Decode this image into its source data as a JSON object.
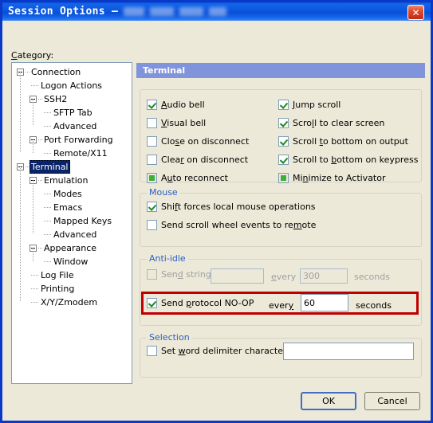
{
  "window": {
    "title_prefix": "Session Options –",
    "title_redacted": true,
    "close_label": "✕"
  },
  "category": {
    "label": "Category:",
    "label_accel": "C",
    "tree": [
      {
        "text": "Connection",
        "depth": 0,
        "expandable": true,
        "selected": false
      },
      {
        "text": "Logon Actions",
        "depth": 1,
        "expandable": false,
        "selected": false
      },
      {
        "text": "SSH2",
        "depth": 1,
        "expandable": true,
        "selected": false
      },
      {
        "text": "SFTP Tab",
        "depth": 2,
        "expandable": false,
        "selected": false
      },
      {
        "text": "Advanced",
        "depth": 2,
        "expandable": false,
        "selected": false
      },
      {
        "text": "Port Forwarding",
        "depth": 1,
        "expandable": true,
        "selected": false
      },
      {
        "text": "Remote/X11",
        "depth": 2,
        "expandable": false,
        "selected": false
      },
      {
        "text": "Terminal",
        "depth": 0,
        "expandable": true,
        "selected": true
      },
      {
        "text": "Emulation",
        "depth": 1,
        "expandable": true,
        "selected": false
      },
      {
        "text": "Modes",
        "depth": 2,
        "expandable": false,
        "selected": false
      },
      {
        "text": "Emacs",
        "depth": 2,
        "expandable": false,
        "selected": false
      },
      {
        "text": "Mapped Keys",
        "depth": 2,
        "expandable": false,
        "selected": false
      },
      {
        "text": "Advanced",
        "depth": 2,
        "expandable": false,
        "selected": false
      },
      {
        "text": "Appearance",
        "depth": 1,
        "expandable": true,
        "selected": false
      },
      {
        "text": "Window",
        "depth": 2,
        "expandable": false,
        "selected": false
      },
      {
        "text": "Log File",
        "depth": 1,
        "expandable": false,
        "selected": false
      },
      {
        "text": "Printing",
        "depth": 1,
        "expandable": false,
        "selected": false
      },
      {
        "text": "X/Y/Zmodem",
        "depth": 1,
        "expandable": false,
        "selected": false
      }
    ]
  },
  "pane": {
    "header": "Terminal",
    "options_left": [
      {
        "label": "Audio bell",
        "accel": "A",
        "state": "checked"
      },
      {
        "label": "Visual bell",
        "accel": "V",
        "state": "unchecked"
      },
      {
        "label": "Close on disconnect",
        "accel": "s",
        "state": "unchecked"
      },
      {
        "label": "Clear on disconnect",
        "accel": "r",
        "state": "unchecked"
      },
      {
        "label": "Auto reconnect",
        "accel": "u",
        "state": "tristate"
      }
    ],
    "options_right": [
      {
        "label": "Jump scroll",
        "accel": "J",
        "state": "checked"
      },
      {
        "label": "Scroll to clear screen",
        "accel": "l",
        "state": "checked"
      },
      {
        "label": "Scroll to bottom on output",
        "accel": "t",
        "state": "checked"
      },
      {
        "label": "Scroll to bottom on keypress",
        "accel": "b",
        "state": "checked"
      },
      {
        "label": "Minimize to Activator",
        "accel": "n",
        "state": "tristate"
      }
    ],
    "mouse": {
      "legend": "Mouse",
      "options": [
        {
          "label": "Shift forces local mouse operations",
          "accel": "f",
          "state": "checked"
        },
        {
          "label": "Send scroll wheel events to remote",
          "accel": "m",
          "state": "unchecked"
        }
      ]
    },
    "anti_idle": {
      "legend": "Anti-idle",
      "send_string": {
        "label": "Send string:",
        "accel": "d",
        "state": "unchecked",
        "enabled": false,
        "value": "",
        "every_label": "every",
        "every_accel": "e",
        "interval": "300",
        "seconds_label": "seconds"
      },
      "send_noop": {
        "label": "Send protocol NO-OP",
        "accel": "p",
        "state": "checked",
        "enabled": true,
        "every_label": "every",
        "every_accel": "y",
        "interval": "60",
        "seconds_label": "seconds",
        "highlighted": true,
        "highlight_color": "#c00000"
      }
    },
    "selection": {
      "legend": "Selection",
      "option": {
        "label": "Set word delimiter characters:",
        "accel": "w",
        "state": "unchecked",
        "value": ""
      }
    }
  },
  "buttons": {
    "ok": "OK",
    "cancel": "Cancel"
  }
}
